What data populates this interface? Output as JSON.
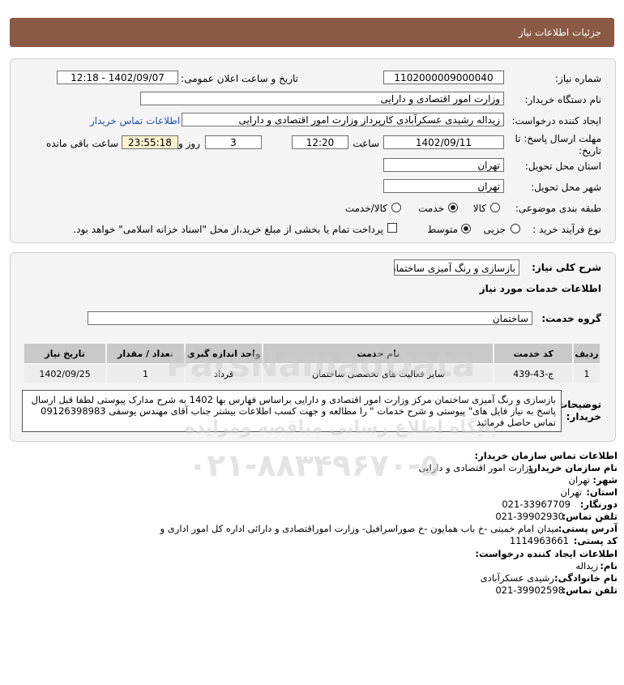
{
  "header": {
    "title": "جزئیات اطلاعات نیاز"
  },
  "form": {
    "need_number_label": "شماره نیاز:",
    "need_number": "1102000009000040",
    "announce_label": "تاریخ و ساعت اعلان عمومی:",
    "announce_value": "1402/09/07 - 12:18",
    "buyer_label": "نام دستگاه خریدار:",
    "buyer_value": "وزارت امور اقتصادی و دارایی",
    "creator_label": "ایجاد کننده درخواست:",
    "creator_value": "زیداله رشیدی عسکرآبادی کارپرداز وزارت امور اقتصادی و دارایی",
    "contact_link": "اطلاعات تماس خریدار",
    "deadline_label_1": "مهلت ارسال پاسخ: تا",
    "deadline_label_2": "تاریخ:",
    "deadline_date": "1402/09/11",
    "time_label": "ساعت",
    "deadline_time": "12:20",
    "days_value": "3",
    "days_label": "روز و",
    "remaining_time": "23:55:18",
    "remaining_label": "ساعت باقی مانده",
    "province_label": "استان محل تحویل:",
    "province_value": "تهران",
    "city_label": "شهر محل تحویل:",
    "city_value": "تهران",
    "category_label": "طبقه بندی موضوعی:",
    "category_options": [
      "کالا",
      "خدمت",
      "کالا/خدمت"
    ],
    "category_selected": "خدمت",
    "process_label": "نوع فرآیند خرید :",
    "process_options": [
      "جزیی",
      "متوسط"
    ],
    "process_selected": "متوسط",
    "payment_note": "پرداخت تمام یا بخشی از مبلغ خرید،از محل \"اسناد خزانه اسلامی\" خواهد بود."
  },
  "need": {
    "summary_label": "شرح کلی نیاز:",
    "summary_value": "بازسازی و رنگ آمیزی ساختمان",
    "services_heading": "اطلاعات خدمات مورد نیاز",
    "service_group_label": "گروه خدمت:",
    "service_group_value": "ساختمان",
    "table": {
      "headers": [
        "ردیف",
        "کد خدمت",
        "نام خدمت",
        "واحد اندازه گیری",
        "تعداد / مقدار",
        "تاریخ نیاز"
      ],
      "rows": [
        [
          "1",
          "ج-43-439",
          "سایر فعالیت های تخصصی ساختمان",
          "قرداد",
          "1",
          "1402/09/25"
        ]
      ]
    },
    "buyer_notes_label_1": "توضیحات",
    "buyer_notes_label_2": "خریدار:",
    "buyer_notes": "بازسازی و رنگ آمیزی ساختمان مرکز وزارت امور اقتصادی و دارایی براساس فهارس بها 1402 به شرح مدارک پیوستی لطفا قبل ارسال پاسخ به نیاز فایل های\" پیوستی و شرح خدمات \" را مطالعه و جهت کسب اطلاعات بیشتر جناب آقای مهندس یوسفی 09126398983 تماس حاصل فرمائید"
  },
  "contact": {
    "heading": "اطلاعات تماس سازمان خریدار:",
    "org_label": "نام سازمان خریدار:",
    "org_value": "وزارت امور اقتصادی و دارایی",
    "city_label": "شهر:",
    "city_value": "تهران",
    "province_label": "استان:",
    "province_value": "تهران",
    "fax_label": "دورنگار:",
    "fax_value": "021-33967709",
    "phone_label": "تلفن تماس:",
    "phone_value": "021-39902930",
    "address_label": "آدرس پستی:",
    "address_value": "میدان امام خمینی -خ باب همایون -خ صوراسرافیل- وزارت اموراقتصادی و دارائی اداره کل امور اداری و",
    "postal_label": "کد پستی:",
    "postal_value": "1114963661",
    "creator_heading": "اطلاعات ایجاد کننده درخواست:",
    "name_label": "نام:",
    "name_value": "زیداله",
    "family_label": "نام خانوادگی:",
    "family_value": "رشیدی عسکرآبادی",
    "creator_phone_label": "تلفن تماس:",
    "creator_phone_value": "021-39902598"
  },
  "watermark": {
    "brand": "ParsNamadData",
    "caption": "پایگاه اطلاع رسانی مناقصه ومزایده",
    "phone": "۰۲۱-۸۸۳۴۹۶۷۰-۵"
  }
}
